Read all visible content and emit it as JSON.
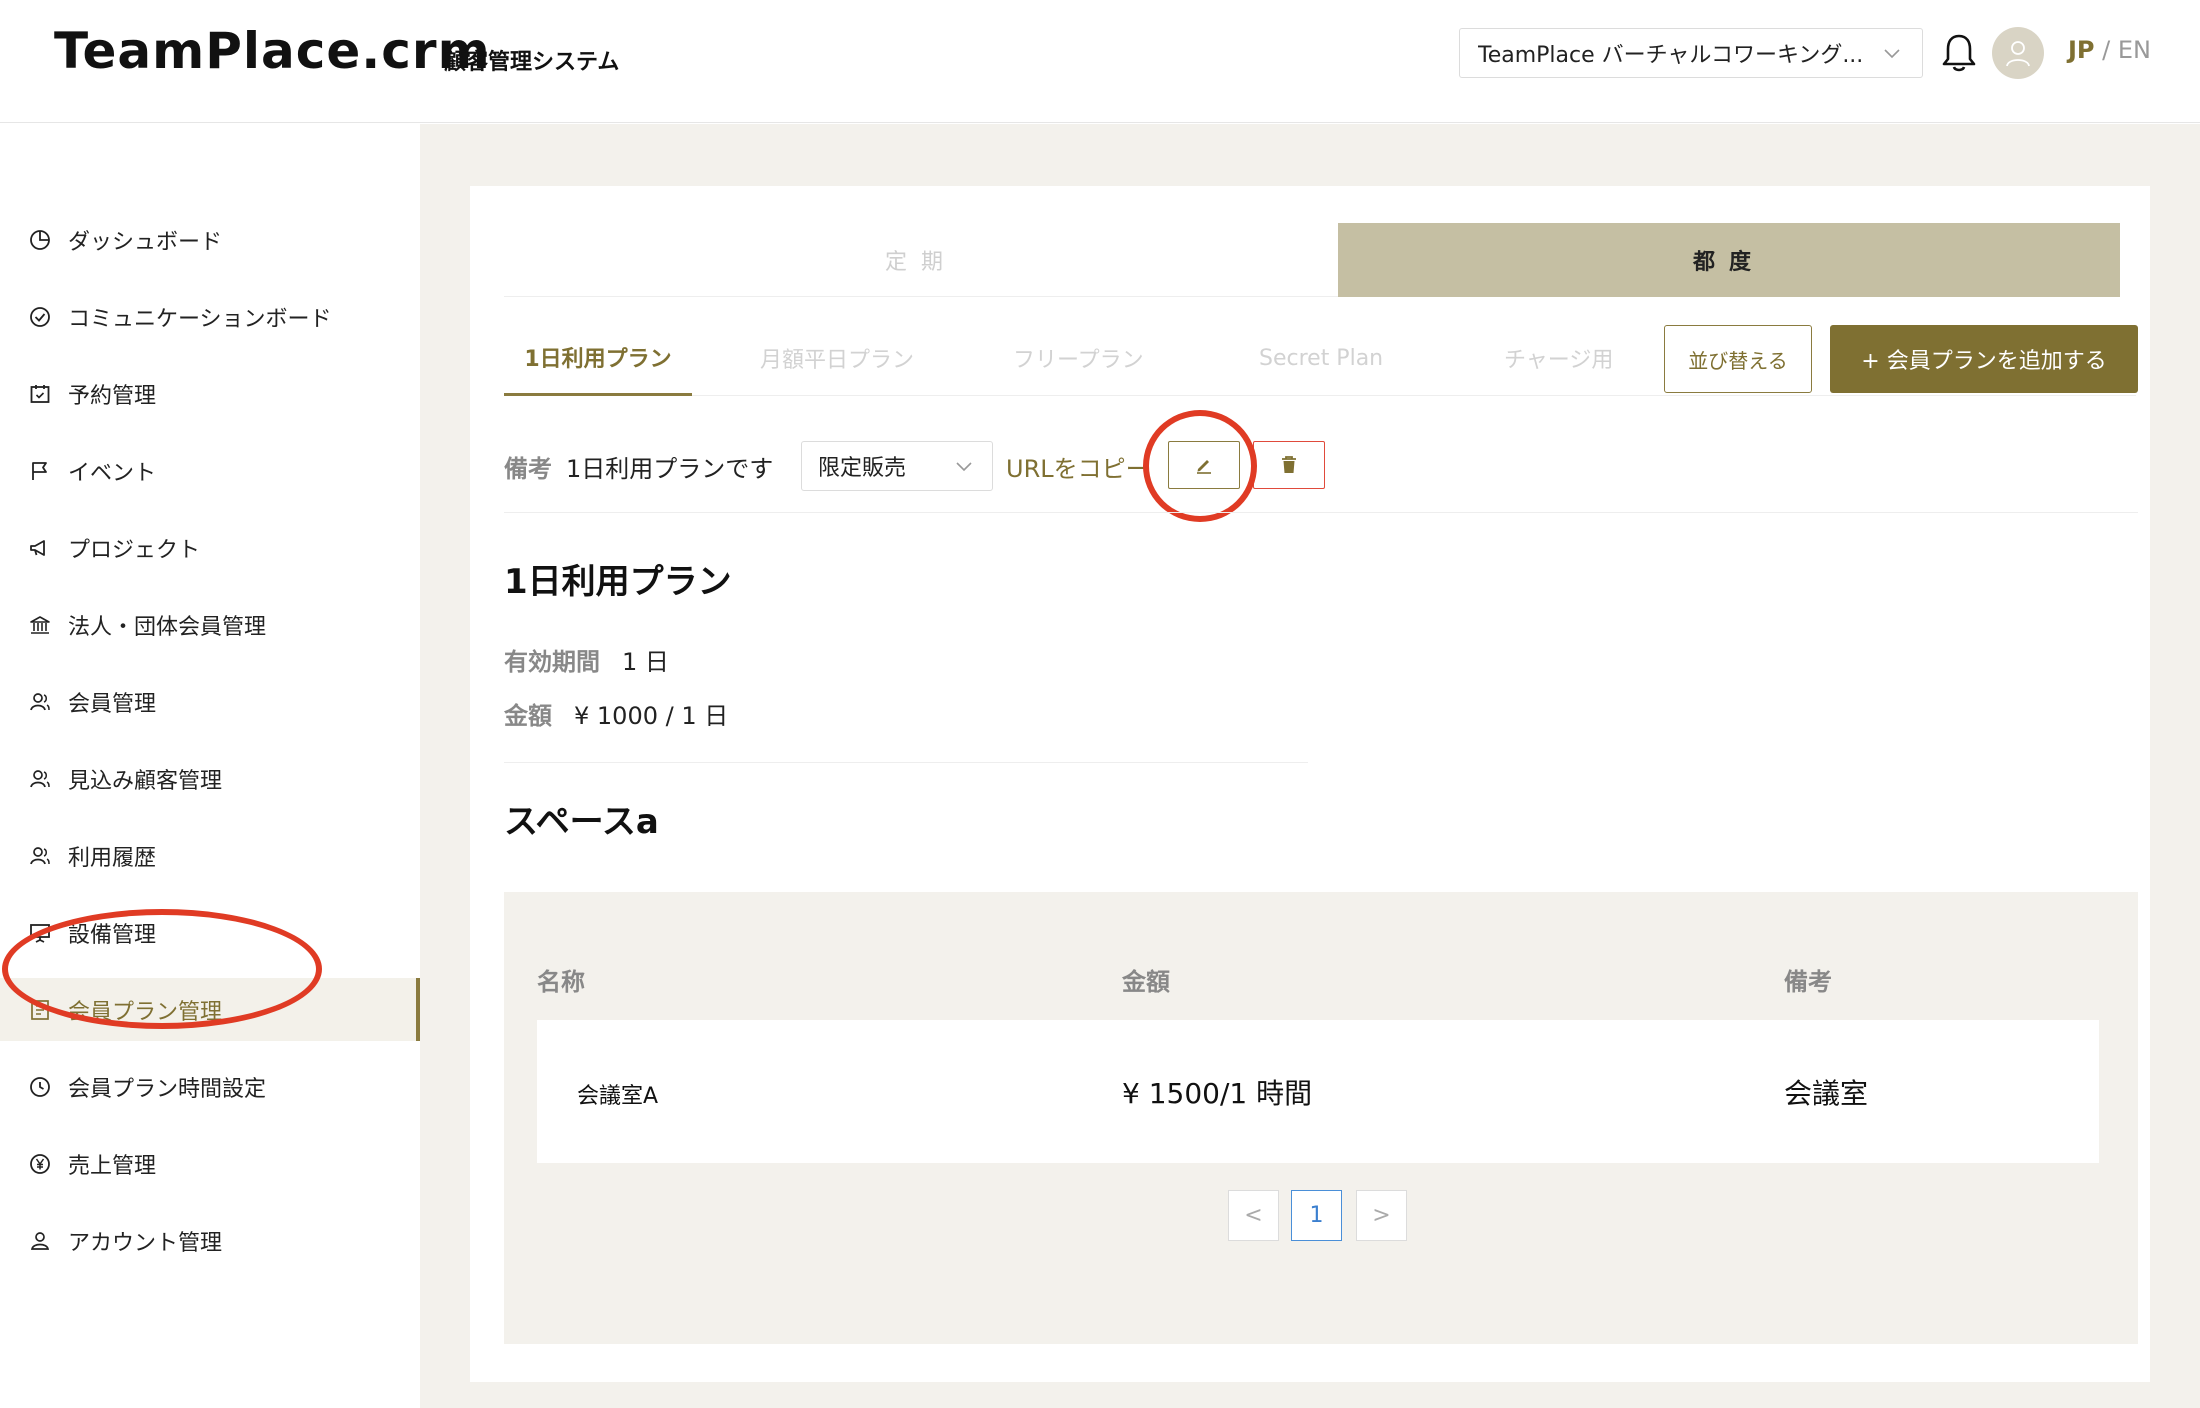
{
  "header": {
    "logo": "TeamPlace.crm",
    "subtitle": "顧客管理システム",
    "workspace": "TeamPlace バーチャルコワーキング...",
    "lang_jp": "JP",
    "lang_sep": " / ",
    "lang_en": "EN"
  },
  "sidebar": {
    "items": [
      {
        "label": "ダッシュボード",
        "icon": "pie-chart-icon"
      },
      {
        "label": "コミュニケーションボード",
        "icon": "check-circle-icon"
      },
      {
        "label": "予約管理",
        "icon": "calendar-check-icon"
      },
      {
        "label": "イベント",
        "icon": "flag-icon"
      },
      {
        "label": "プロジェクト",
        "icon": "megaphone-icon"
      },
      {
        "label": "法人・団体会員管理",
        "icon": "bank-icon"
      },
      {
        "label": "会員管理",
        "icon": "users-icon"
      },
      {
        "label": "見込み顧客管理",
        "icon": "users-icon"
      },
      {
        "label": "利用履歴",
        "icon": "users-icon"
      },
      {
        "label": "設備管理",
        "icon": "projector-icon"
      },
      {
        "label": "会員プラン管理",
        "icon": "document-list-icon",
        "active": true
      },
      {
        "label": "会員プラン時間設定",
        "icon": "clock-icon"
      },
      {
        "label": "売上管理",
        "icon": "yen-circle-icon"
      },
      {
        "label": "アカウント管理",
        "icon": "user-settings-icon"
      }
    ]
  },
  "segment_tabs": {
    "periodic": "定期",
    "per_use": "都度"
  },
  "plan_tabs": [
    "1日利用プラン",
    "月額平日プラン",
    "フリープラン",
    "Secret Plan",
    "チャージ用"
  ],
  "actions": {
    "sort": "並び替える",
    "add": "+ 会員プランを追加する"
  },
  "note": {
    "label": "備考",
    "text": "1日利用プランです",
    "sale_status": "限定販売",
    "copy_url": "URLをコピー"
  },
  "plan": {
    "title": "1日利用プラン",
    "validity_label": "有効期間",
    "validity_value": "1 日",
    "price_label": "金額",
    "price_value": "¥ 1000 / 1 日"
  },
  "space": {
    "title": "スペースa",
    "headers": {
      "name": "名称",
      "price": "金額",
      "note": "備考"
    },
    "rows": [
      {
        "name": "会議室A",
        "price": "¥ 1500/1 時間",
        "note": "会議室"
      }
    ]
  },
  "pagination": {
    "prev": "<",
    "current": "1",
    "next": ">"
  },
  "colors": {
    "accent": "#7f7032",
    "accent_light": "#c5bfa3",
    "panel_bg": "#f3f1ec",
    "annotation": "#e03b24",
    "danger": "#e04a3b"
  }
}
